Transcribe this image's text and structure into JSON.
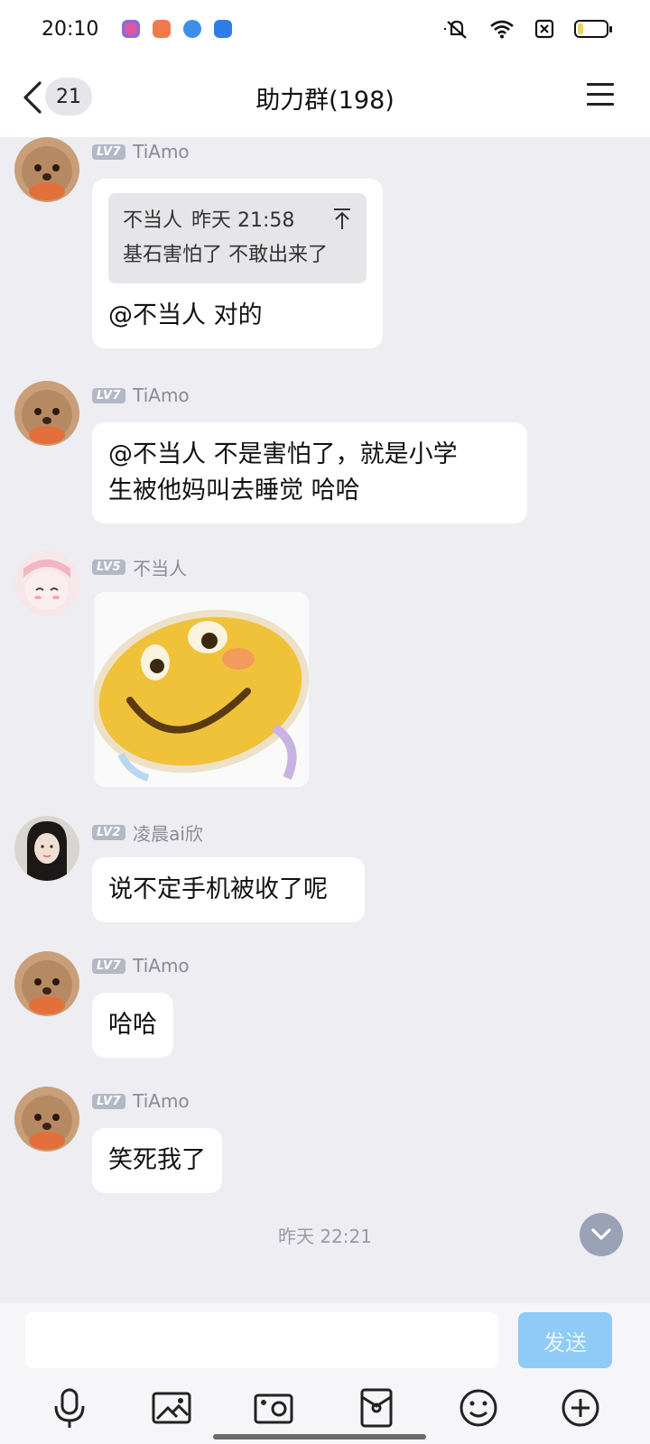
{
  "status": {
    "time": "20:10"
  },
  "header": {
    "unread_count": "21",
    "title": "助力群(198)"
  },
  "messages": [
    {
      "level": "LV7",
      "sender": "TiAmo",
      "quote": {
        "author": "不当人",
        "time": "昨天 21:58",
        "text": "基石害怕了 不敢出来了"
      },
      "text": "@不当人 对的"
    },
    {
      "level": "LV7",
      "sender": "TiAmo",
      "text_lines": [
        "@不当人 不是害怕了，就是小学",
        "生被他妈叫去睡觉 哈哈"
      ]
    },
    {
      "level": "LV5",
      "sender": "不当人",
      "sticker": "smiling-face-sticker"
    },
    {
      "level": "LV2",
      "sender": "凌晨ai欣",
      "text": "说不定手机被收了呢"
    },
    {
      "level": "LV7",
      "sender": "TiAmo",
      "text": "哈哈"
    },
    {
      "level": "LV7",
      "sender": "TiAmo",
      "text": "笑死我了"
    }
  ],
  "timestamp": "昨天 22:21",
  "composer": {
    "placeholder": "",
    "send_label": "发送"
  },
  "toolbar": [
    "microphone-icon",
    "image-icon",
    "camera-icon",
    "red-packet-icon",
    "emoji-icon",
    "plus-icon"
  ],
  "colors": {
    "background": "#ededf2",
    "bubble": "#ffffff",
    "send_button": "#8ecbf7",
    "level_badge": "#b2b8c6"
  }
}
